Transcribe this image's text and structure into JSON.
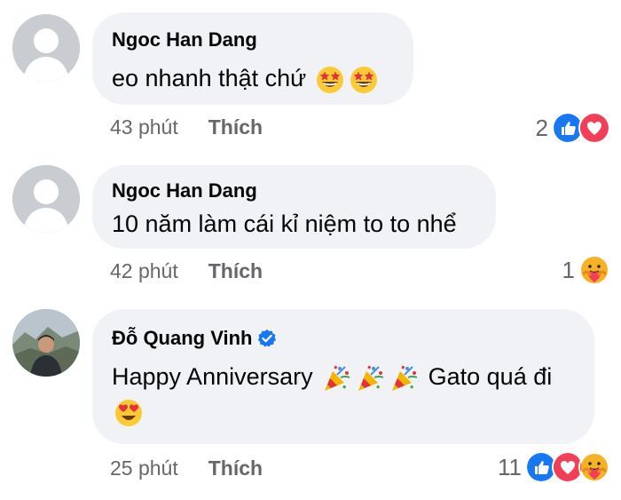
{
  "comments": [
    {
      "author": "Ngoc Han Dang",
      "text": "eo nhanh thật chứ",
      "time": "43 phút",
      "like_label": "Thích",
      "reaction_count": "2",
      "reactions": [
        "like-icon",
        "love-icon"
      ],
      "emojis": [
        "star-struck-emoji",
        "star-struck-emoji"
      ]
    },
    {
      "author": "Ngoc Han Dang",
      "text": "10 năm làm cái kỉ niệm to to nhể",
      "time": "42 phút",
      "like_label": "Thích",
      "reaction_count": "1",
      "reactions": [
        "care-icon"
      ]
    },
    {
      "author": "Đỗ Quang Vinh",
      "verified": true,
      "text_part1": "Happy Anniversary",
      "text_part2": "Gato quá đi",
      "time": "25 phút",
      "like_label": "Thích",
      "reaction_count": "11",
      "reactions": [
        "like-icon",
        "love-icon",
        "care-icon"
      ],
      "emojis": [
        "party-popper-emoji",
        "party-popper-emoji",
        "party-popper-emoji",
        "heart-eyes-emoji"
      ]
    }
  ],
  "colors": {
    "bubble": "#f0f2f5",
    "like_blue": "#1877f2",
    "love_red": "#f33e58",
    "meta_gray": "#65676b"
  }
}
